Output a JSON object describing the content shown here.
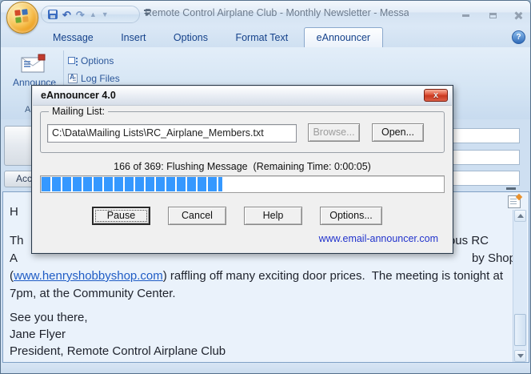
{
  "titlebar": {
    "title": "Remote Control Airplane Club - Monthly Newsletter - Messa...",
    "help_glyph": "?"
  },
  "ribbon_tabs": {
    "items": [
      "Message",
      "Insert",
      "Options",
      "Format Text",
      "eAnnouncer"
    ],
    "active": "eAnnouncer"
  },
  "ribbon": {
    "announce_button": "Announce",
    "options_button": "Options",
    "log_files_button": "Log Files",
    "group_label": "Announce"
  },
  "compose": {
    "account_button": "Account",
    "fields": [
      "",
      "",
      ""
    ]
  },
  "dialog": {
    "title": "eAnnouncer 4.0",
    "close_glyph": "x",
    "mailing_list": {
      "label": "Mailing List:",
      "path": "C:\\Data\\Mailing Lists\\RC_Airplane_Members.txt",
      "browse_button": "Browse...",
      "open_button": "Open..."
    },
    "progress": {
      "status": "166 of 369: Flushing Message  (Remaining Time: 0:00:05)",
      "current": 166,
      "total": 369,
      "percent": 45,
      "bar_color": "#3598ff"
    },
    "buttons": [
      "Pause",
      "Cancel",
      "Help",
      "Options..."
    ],
    "vendor_link": "www.email-announcer.com",
    "link_color": "#2233cc"
  },
  "message_body": {
    "greeting_fragment": "H",
    "para_line1_left": "Th",
    "para_line1_right": "ous RC",
    "para_line2_left": "A",
    "para_line2_right": "by Shop",
    "para_line3_prefix": "(",
    "para_line3_link": "www.henryshobbyshop.com",
    "para_line3_suffix": ") raffling off many exciting door prices.  The meeting is tonight at",
    "para_line4": "7pm, at the Community Center.",
    "closing": "See you there,",
    "signer": "Jane Flyer",
    "signer_title": "President, Remote Control Airplane Club"
  }
}
